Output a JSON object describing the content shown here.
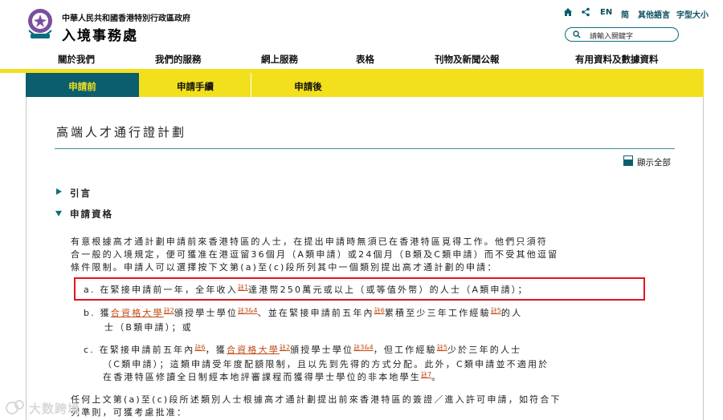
{
  "header": {
    "gov_name": "中華人民共和國香港特別行政區政府",
    "dept_name": "入境事務處",
    "utils": {
      "home_icon": "home-icon",
      "share_icon": "share-icon",
      "en": "EN",
      "simplified": "简",
      "other_lang": "其他語言",
      "font_size": "字型大小"
    },
    "search": {
      "placeholder": "請輸入關鍵字"
    }
  },
  "topnav": [
    "關於我們",
    "我們的服務",
    "網上服務",
    "表格",
    "刊物及新聞公報",
    "有用資料及數據資料"
  ],
  "subtabs": [
    "申請前",
    "申請手續",
    "申請後"
  ],
  "main": {
    "title": "高端人才通行證計劃",
    "expand_all": "顯示全部",
    "sections": [
      "引言",
      "申請資格"
    ],
    "intro_lines": [
      "有意根據高才通計劃申請前來香港特區的人士，在提出申請時無須已在香港特區覓得工作。他們只須符",
      "合一般的入境規定，便可獲准在港逗留36個月（A類申請）或24個月（B類及C類申請）而不受其他逗留",
      "條件限制。申請人可以選擇按下文第(a)至(c)段所列其中一個類別提出高才通計劃的申請："
    ],
    "item_a": {
      "marker": "a.",
      "part1": "在緊接申請前一年，全年收入",
      "fn1": "註1",
      "part2": "達港幣250萬元或以上（或等值外幣）的人士（A類申請）；"
    },
    "item_b": {
      "marker": "b.",
      "part1": "獲",
      "link": "合資格大學",
      "fn1": "註2",
      "part2": "頒授學士學位",
      "fn2": "註3&4",
      "part3": "、並在緊接申請前五年內",
      "fn3": "註6",
      "part4": "累積至少三年工作經驗",
      "fn4": "註5",
      "part5": "的人",
      "line2": "士（B類申請）；或"
    },
    "item_c": {
      "marker": "c.",
      "part1": "在緊接申請前五年內",
      "fn1": "註6",
      "part2": "，獲",
      "link": "合資格大學",
      "fn2": "註2",
      "part3": "頒授學士學位",
      "fn3": "註3&4",
      "part4": "，但工作經驗",
      "fn4": "註5",
      "part5": "少於三年的人士",
      "line2": "（C類申請）；這類申請受年度配額限制，且以先到先得的方式分配。此外，C類申請並不適用於",
      "line3a": "在香港特區修讀全日制經本地評審課程而獲得學士學位的非本地學生",
      "fn5": "註7",
      "line3b": "。"
    },
    "closing_lines": [
      "任何上文第(a)至(c)段所述類別人士根據高才通計劃提出前來香港特區的簽證／進入許可申請，如符合下",
      "列準則，可獲考慮批准："
    ]
  },
  "watermark": {
    "text": "大数跨境"
  },
  "colors": {
    "teal": "#0b5e6e",
    "yellow": "#f3e01d",
    "footnote": "#c24a16",
    "highlight": "#e0161b"
  }
}
